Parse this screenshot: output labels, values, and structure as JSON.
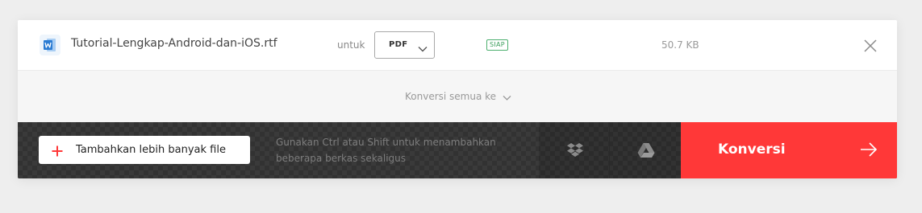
{
  "file": {
    "icon": "word-document-icon",
    "name": "Tutorial-Lengkap-Android-dan-iOS.rtf",
    "for_label": "untuk",
    "format_value": "PDF",
    "status": "SIAP",
    "size": "50.7 KB"
  },
  "convert_all": {
    "label": "Konversi semua ke"
  },
  "bottom_bar": {
    "add_more_label": "Tambahkan lebih banyak file",
    "hint": "Gunakan Ctrl atau Shift untuk menambahkan beberapa berkas sekaligus",
    "dropbox_icon": "dropbox-icon",
    "drive_icon": "google-drive-icon",
    "convert_label": "Konversi"
  },
  "colors": {
    "accent": "#ff3838",
    "status_green": "#3c9e5c",
    "word_blue": "#2b7cd3",
    "bar_dark": "#323232"
  }
}
